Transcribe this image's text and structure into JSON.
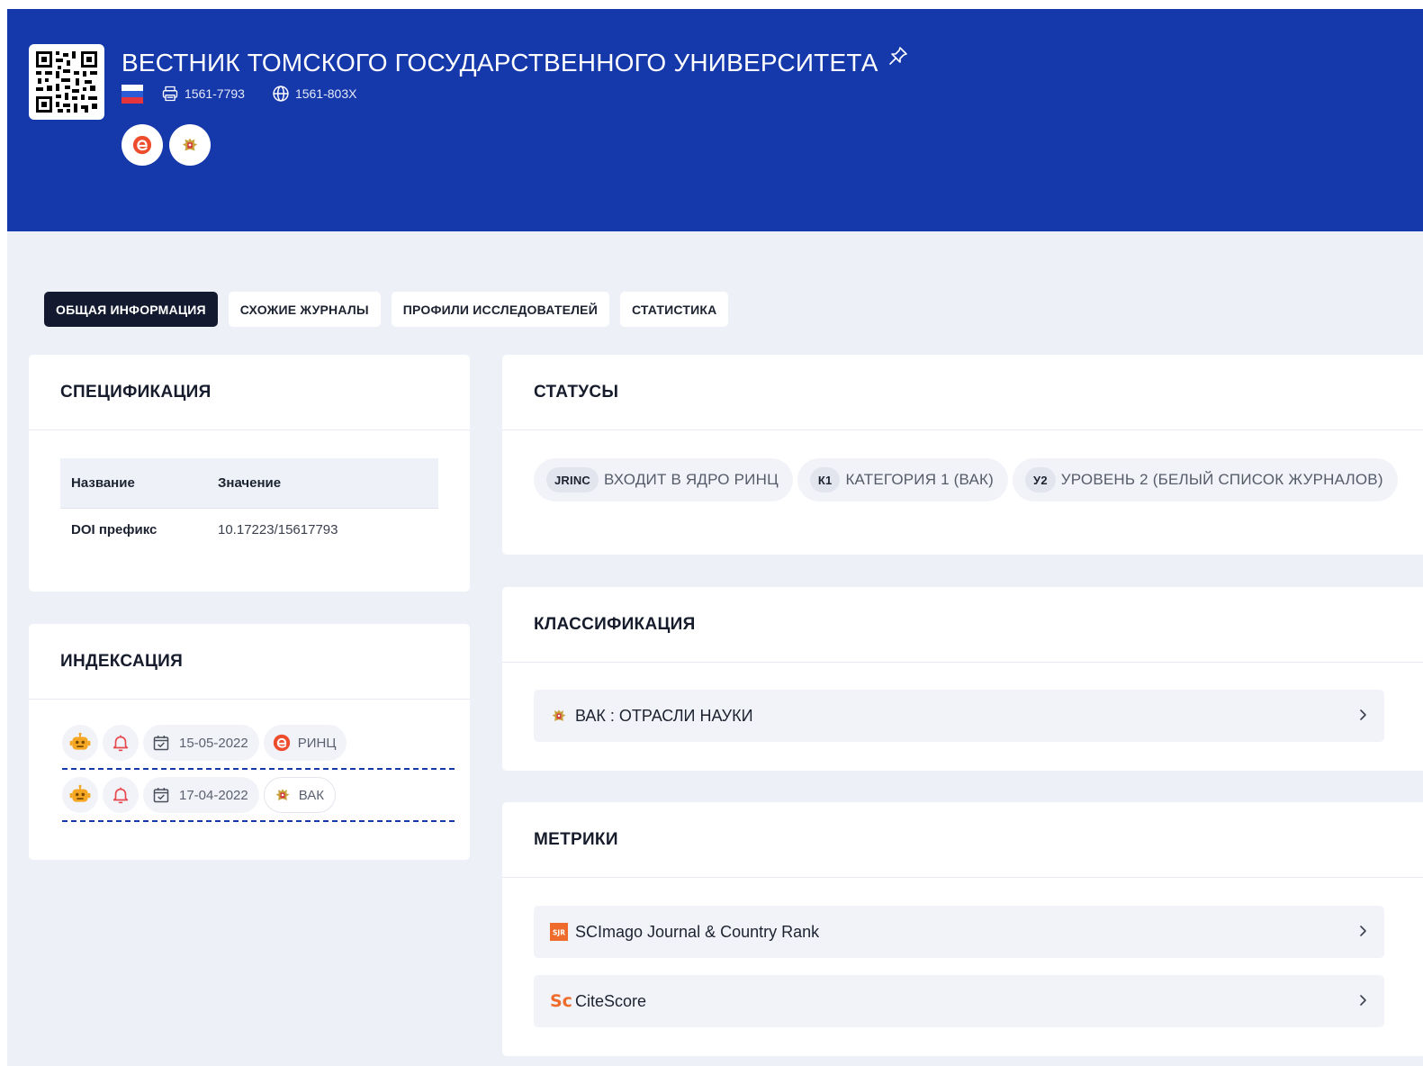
{
  "header": {
    "title": "ВЕСТНИК ТОМСКОГО ГОСУДАРСТВЕННОГО УНИВЕРСИТЕТА",
    "print_issn": "1561-7793",
    "online_issn": "1561-803X",
    "icons": [
      "qr-code-icon",
      "pin-icon",
      "russia-flag-icon",
      "printer-icon",
      "globe-icon",
      "elibrary-logo-icon",
      "vak-emblem-icon"
    ]
  },
  "tabs": [
    {
      "label": "ОБЩАЯ ИНФОРМАЦИЯ",
      "active": true
    },
    {
      "label": "СХОЖИЕ ЖУРНАЛЫ",
      "active": false
    },
    {
      "label": "ПРОФИЛИ ИССЛЕДОВАТЕЛЕЙ",
      "active": false
    },
    {
      "label": "СТАТИСТИКА",
      "active": false
    }
  ],
  "spec": {
    "title": "СПЕЦИФИКАЦИЯ",
    "col_name": "Название",
    "col_value": "Значение",
    "rows": [
      {
        "name": "DOI префикс",
        "value": "10.17223/15617793"
      }
    ]
  },
  "indexing": {
    "title": "ИНДЕКСАЦИЯ",
    "rows": [
      {
        "date": "15-05-2022",
        "source": "РИНЦ"
      },
      {
        "date": "17-04-2022",
        "source": "ВАК"
      }
    ]
  },
  "statuses": {
    "title": "СТАТУСЫ",
    "items": [
      {
        "code": "JRINC",
        "label": "ВХОДИТ В ЯДРО РИНЦ"
      },
      {
        "code": "К1",
        "label": "КАТЕГОРИЯ 1 (ВАК)"
      },
      {
        "code": "У2",
        "label": "УРОВЕНЬ 2 (БЕЛЫЙ СПИСОК ЖУРНАЛОВ)"
      }
    ]
  },
  "classification": {
    "title": "КЛАССИФИКАЦИЯ",
    "items": [
      {
        "label": "ВАК : ОТРАСЛИ НАУКИ"
      }
    ]
  },
  "metrics": {
    "title": "МЕТРИКИ",
    "items": [
      {
        "label": "SCImago Journal & Country Rank",
        "badge": "SJR"
      },
      {
        "label": "CiteScore",
        "badge": "Sc"
      }
    ]
  },
  "colors": {
    "header_bg": "#1538ab",
    "page_bg": "#eef0f7",
    "active_tab_bg": "#131a30",
    "bot_icon": "#f5a623",
    "bell_icon": "#e5484d",
    "sjr_orange": "#ee6b2b"
  }
}
